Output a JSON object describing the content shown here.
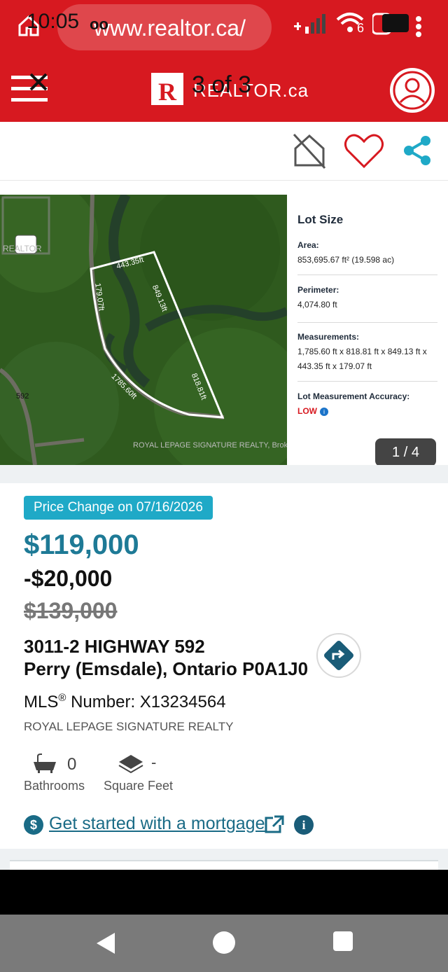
{
  "status_bar": {
    "time": "10:05",
    "voicemail": "oo",
    "url": "www.realtor.ca/",
    "tab_count": "6"
  },
  "header": {
    "brand_letter": "R",
    "brand_text": "REALTOR.ca",
    "page_indicator": "3 of 3"
  },
  "gallery": {
    "watermark_logo_text": "REALTOR",
    "watermark_credit": "ROYAL LEPAGE SIGNATURE REALTY, Brokerage",
    "road_label": "592",
    "lot_dimensions": [
      "443.35ft",
      "849.13ft",
      "179.07ft",
      "1785.60ft",
      "818.81ft"
    ],
    "counter": "1 / 4"
  },
  "lot": {
    "title": "Lot Size",
    "area_label": "Area:",
    "area_value": "853,695.67 ft² (19.598 ac)",
    "perimeter_label": "Perimeter:",
    "perimeter_value": "4,074.80 ft",
    "measurements_label": "Measurements:",
    "measurements_value": "1,785.60 ft x 818.81 ft x 849.13 ft x 443.35 ft x 179.07 ft",
    "accuracy_label": "Lot Measurement Accuracy:",
    "accuracy_value": "LOW",
    "accuracy_info": "i"
  },
  "listing": {
    "badge": "Price Change on 07/16/2026",
    "price": "$119,000",
    "price_change": "-$20,000",
    "old_price": "$139,000",
    "address_line1": "3011-2 HIGHWAY 592",
    "address_line2": "Perry (Emsdale), Ontario P0A1J0",
    "mls_prefix": "MLS",
    "mls_reg": "®",
    "mls_suffix": " Number: X13234564",
    "brokerage": "ROYAL LEPAGE SIGNATURE REALTY",
    "bathrooms_value": "0",
    "bathrooms_label": "Bathrooms",
    "sqft_value": "-",
    "sqft_label": "Square Feet",
    "mortgage_icon": "$",
    "mortgage_link": "Get started with a mortgage",
    "mortgage_info": "i"
  },
  "colors": {
    "brand_red": "#d71920",
    "price_blue": "#1e7a96",
    "badge_teal": "#1fa9c7",
    "link_blue": "#1a6b86"
  }
}
